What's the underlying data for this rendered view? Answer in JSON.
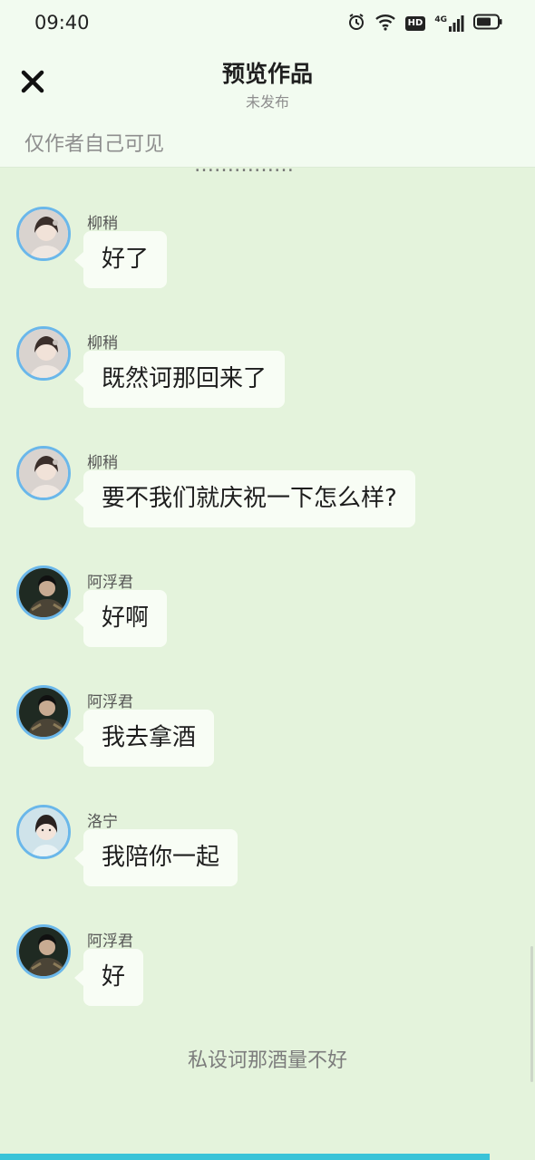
{
  "status": {
    "time": "09:40",
    "icons": [
      "alarm-icon",
      "wifi-icon",
      "hd-badge-icon",
      "signal-4g-icon",
      "battery-icon"
    ],
    "hd_label": "HD",
    "network_label": "4G"
  },
  "header": {
    "close_icon": "close-icon",
    "title": "预览作品",
    "subtitle": "未发布",
    "visibility_note": "仅作者自己可见"
  },
  "chat": {
    "clipped_text": "……………",
    "messages": [
      {
        "sender": "柳稍",
        "text": "好了",
        "avatar": "liushao"
      },
      {
        "sender": "柳稍",
        "text": "既然诃那回来了",
        "avatar": "liushao"
      },
      {
        "sender": "柳稍",
        "text": "要不我们就庆祝一下怎么样?",
        "avatar": "liushao"
      },
      {
        "sender": "阿浮君",
        "text": "好啊",
        "avatar": "afujun"
      },
      {
        "sender": "阿浮君",
        "text": "我去拿酒",
        "avatar": "afujun"
      },
      {
        "sender": "洛宁",
        "text": "我陪你一起",
        "avatar": "luoning"
      },
      {
        "sender": "阿浮君",
        "text": "好",
        "avatar": "afujun"
      }
    ],
    "footer_note": "私设诃那酒量不好"
  },
  "colors": {
    "background": "#e4f3dc",
    "header_bg": "#f2fbf0",
    "bubble_bg": "#f8fdf5",
    "avatar_ring": "#6ab7ea",
    "accent_strip": "#39c3d8"
  }
}
